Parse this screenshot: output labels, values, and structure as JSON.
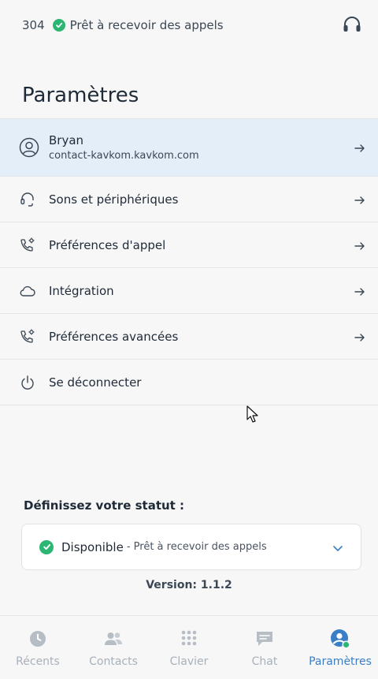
{
  "header": {
    "extension": "304",
    "status": "Prêt à recevoir des appels",
    "status_icon": "check-circle-icon",
    "headset_icon": "headset-icon"
  },
  "page": {
    "title": "Paramètres"
  },
  "menu": {
    "profile": {
      "name": "Bryan",
      "email": "contact-kavkom.kavkom.com",
      "icon": "user-circle-icon"
    },
    "items": [
      {
        "label": "Sons et périphériques",
        "icon": "headset-icon"
      },
      {
        "label": "Préférences d'appel",
        "icon": "phone-settings-icon"
      },
      {
        "label": "Intégration",
        "icon": "cloud-icon"
      },
      {
        "label": "Préférences avancées",
        "icon": "phone-settings-icon"
      },
      {
        "label": "Se déconnecter",
        "icon": "power-icon"
      }
    ]
  },
  "status_section": {
    "heading": "Définissez votre statut :",
    "selected": "Disponible",
    "description": "- Prêt à recevoir des appels",
    "color": "#2bb673"
  },
  "version": "Version: 1.1.2",
  "tabs": [
    {
      "label": "Récents",
      "icon": "clock-icon",
      "active": false
    },
    {
      "label": "Contacts",
      "icon": "contacts-icon",
      "active": false
    },
    {
      "label": "Clavier",
      "icon": "keypad-icon",
      "active": false
    },
    {
      "label": "Chat",
      "icon": "chat-icon",
      "active": false
    },
    {
      "label": "Paramètres",
      "icon": "settings-user-icon",
      "active": true
    }
  ],
  "colors": {
    "accent": "#3a7fc6",
    "available": "#2bb673",
    "profile_bg": "#e3eef9"
  }
}
